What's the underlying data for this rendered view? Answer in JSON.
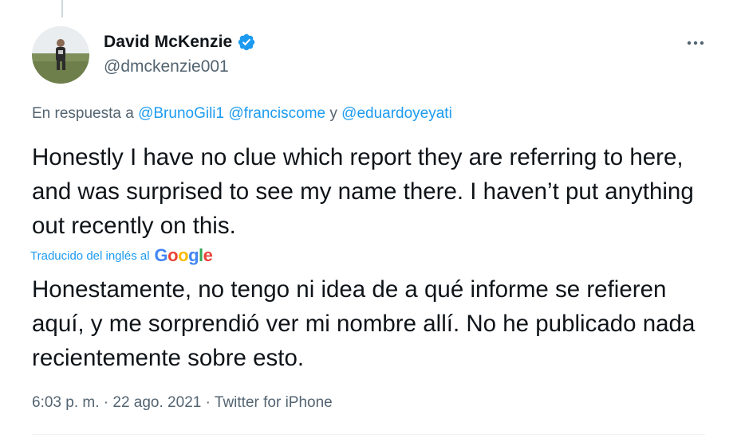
{
  "author": {
    "display_name": "David McKenzie",
    "handle": "@dmckenzie001",
    "verified": true
  },
  "reply": {
    "prefix": "En respuesta a",
    "mention1": "@BrunoGili1",
    "mention2": "@franciscome",
    "conjunction": "y",
    "mention3": "@eduardoyeyati"
  },
  "tweet": {
    "text": "Honestly I have no clue which report they are referring to here, and was surprised to see my name there. I haven’t put anything out recently on this."
  },
  "translation": {
    "label": "Traducido del inglés al",
    "logo_text": "Google",
    "text": "Honestamente, no tengo ni idea de a qué informe se refieren aquí, y me sorprendió ver mi nombre allí. No he publicado nada recientemente sobre esto."
  },
  "meta": {
    "time": "6:03 p. m.",
    "date": "22 ago. 2021",
    "source": "Twitter for iPhone",
    "separator": "·"
  },
  "colors": {
    "link": "#1d9bf0",
    "secondary_text": "#536471",
    "primary_text": "#0f1419",
    "verified": "#1d9bf0"
  },
  "icons": {
    "verified": "verified-badge-icon",
    "more": "more-options-icon"
  }
}
